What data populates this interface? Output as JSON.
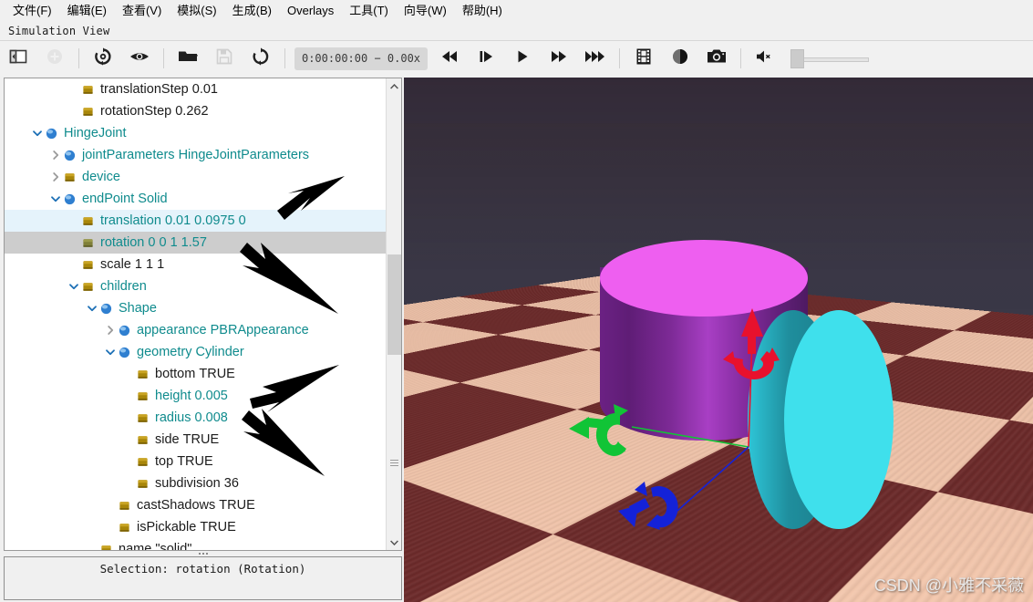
{
  "menu": {
    "items": [
      {
        "label": "文件(F)",
        "name": "menu-file"
      },
      {
        "label": "编辑(E)",
        "name": "menu-edit"
      },
      {
        "label": "查看(V)",
        "name": "menu-view"
      },
      {
        "label": "模拟(S)",
        "name": "menu-simulation"
      },
      {
        "label": "生成(B)",
        "name": "menu-build"
      },
      {
        "label": "Overlays",
        "name": "menu-overlays"
      },
      {
        "label": "工具(T)",
        "name": "menu-tools"
      },
      {
        "label": "向导(W)",
        "name": "menu-wizards"
      },
      {
        "label": "帮助(H)",
        "name": "menu-help"
      }
    ]
  },
  "view_bar": {
    "label": "Simulation View"
  },
  "toolbar": {
    "timecode": "0:00:00:00 −  0.00x",
    "buttons": [
      {
        "name": "toggle-sidebar-button",
        "icon": "panel-toggle-icon",
        "title": "Toggle side panel"
      },
      {
        "name": "add-node-button",
        "icon": "plus-circle-icon",
        "title": "Add node"
      },
      {
        "name": "reload-world-button",
        "icon": "reload-world-icon",
        "title": "Reload world"
      },
      {
        "name": "view-eye-button",
        "icon": "eye-icon",
        "title": "View"
      },
      {
        "name": "open-world-button",
        "icon": "folder-open-icon",
        "title": "Open world"
      },
      {
        "name": "save-world-button",
        "icon": "floppy-save-icon",
        "title": "Save world"
      },
      {
        "name": "reset-simulation-button",
        "icon": "refresh-circular-icon",
        "title": "Reset simulation"
      },
      {
        "name": "rewind-button",
        "icon": "skip-back-icon",
        "title": "Rewind"
      },
      {
        "name": "step-button",
        "icon": "step-forward-icon",
        "title": "Step"
      },
      {
        "name": "play-button",
        "icon": "play-icon",
        "title": "Play"
      },
      {
        "name": "fast-forward-button",
        "icon": "fast-forward-icon",
        "title": "Fast forward"
      },
      {
        "name": "run-fast-button",
        "icon": "run-fast-icon",
        "title": "Run as fast as possible"
      },
      {
        "name": "movie-record-button",
        "icon": "film-strip-icon",
        "title": "Make movie"
      },
      {
        "name": "animation-record-button",
        "icon": "record-circle-icon",
        "title": "Make animation"
      },
      {
        "name": "screenshot-button",
        "icon": "camera-icon",
        "title": "Take screenshot"
      },
      {
        "name": "sound-button",
        "icon": "speaker-mute-icon",
        "title": "Sound volume"
      }
    ]
  },
  "tree": {
    "rows": [
      {
        "name": "tree-item-translationStep",
        "indent": 3,
        "twisty": "none",
        "icon": "field-square-yellow",
        "label": "translationStep",
        "value": "0.01",
        "label_color": "plain",
        "selected": "none"
      },
      {
        "name": "tree-item-rotationStep",
        "indent": 3,
        "twisty": "none",
        "icon": "field-square-yellow",
        "label": "rotationStep",
        "value": "0.262",
        "label_color": "plain",
        "selected": "none"
      },
      {
        "name": "tree-item-HingeJoint",
        "indent": 1,
        "twisty": "open",
        "icon": "node-sphere-blue",
        "label": "HingeJoint",
        "value": "",
        "label_color": "teal",
        "selected": "none"
      },
      {
        "name": "tree-item-jointParameters",
        "indent": 2,
        "twisty": "closed",
        "icon": "node-sphere-blue",
        "label": "jointParameters",
        "value": "HingeJointParameters",
        "label_color": "teal",
        "selected": "none"
      },
      {
        "name": "tree-item-device",
        "indent": 2,
        "twisty": "closed",
        "icon": "field-square-yellow",
        "label": "device",
        "value": "",
        "label_color": "teal",
        "selected": "none"
      },
      {
        "name": "tree-item-endPoint",
        "indent": 2,
        "twisty": "open",
        "icon": "node-sphere-blue",
        "label": "endPoint",
        "value": "Solid",
        "label_color": "teal",
        "selected": "none"
      },
      {
        "name": "tree-item-translation",
        "indent": 3,
        "twisty": "none",
        "icon": "field-square-yellow",
        "label": "translation",
        "value": "0.01 0.0975 0",
        "label_color": "teal",
        "selected": "blue"
      },
      {
        "name": "tree-item-rotation",
        "indent": 3,
        "twisty": "none",
        "icon": "field-square-olive",
        "label": "rotation",
        "value": "0 0 1 1.57",
        "label_color": "teal",
        "selected": "gray"
      },
      {
        "name": "tree-item-scale",
        "indent": 3,
        "twisty": "none",
        "icon": "field-square-yellow",
        "label": "scale",
        "value": "1 1 1",
        "label_color": "plain",
        "selected": "none"
      },
      {
        "name": "tree-item-children",
        "indent": 3,
        "twisty": "open",
        "icon": "field-square-yellow",
        "label": "children",
        "value": "",
        "label_color": "teal",
        "selected": "none"
      },
      {
        "name": "tree-item-Shape",
        "indent": 4,
        "twisty": "open",
        "icon": "node-sphere-blue",
        "label": "Shape",
        "value": "",
        "label_color": "teal",
        "selected": "none"
      },
      {
        "name": "tree-item-appearance",
        "indent": 5,
        "twisty": "closed",
        "icon": "node-sphere-blue",
        "label": "appearance",
        "value": "PBRAppearance",
        "label_color": "teal",
        "selected": "none"
      },
      {
        "name": "tree-item-geometry",
        "indent": 5,
        "twisty": "open",
        "icon": "node-sphere-blue",
        "label": "geometry",
        "value": "Cylinder",
        "label_color": "teal",
        "selected": "none"
      },
      {
        "name": "tree-item-bottom",
        "indent": 6,
        "twisty": "none",
        "icon": "field-square-yellow",
        "label": "bottom",
        "value": "TRUE",
        "label_color": "plain",
        "selected": "none"
      },
      {
        "name": "tree-item-height",
        "indent": 6,
        "twisty": "none",
        "icon": "field-square-yellow",
        "label": "height",
        "value": "0.005",
        "label_color": "teal",
        "selected": "none"
      },
      {
        "name": "tree-item-radius",
        "indent": 6,
        "twisty": "none",
        "icon": "field-square-yellow",
        "label": "radius",
        "value": "0.008",
        "label_color": "teal",
        "selected": "none"
      },
      {
        "name": "tree-item-side",
        "indent": 6,
        "twisty": "none",
        "icon": "field-square-yellow",
        "label": "side",
        "value": "TRUE",
        "label_color": "plain",
        "selected": "none"
      },
      {
        "name": "tree-item-top",
        "indent": 6,
        "twisty": "none",
        "icon": "field-square-yellow",
        "label": "top",
        "value": "TRUE",
        "label_color": "plain",
        "selected": "none"
      },
      {
        "name": "tree-item-subdivision",
        "indent": 6,
        "twisty": "none",
        "icon": "field-square-yellow",
        "label": "subdivision",
        "value": "36",
        "label_color": "plain",
        "selected": "none"
      },
      {
        "name": "tree-item-castShadows",
        "indent": 5,
        "twisty": "none",
        "icon": "field-square-yellow",
        "label": "castShadows",
        "value": "TRUE",
        "label_color": "plain",
        "selected": "none"
      },
      {
        "name": "tree-item-isPickable",
        "indent": 5,
        "twisty": "none",
        "icon": "field-square-yellow",
        "label": "isPickable",
        "value": "TRUE",
        "label_color": "plain",
        "selected": "none"
      },
      {
        "name": "tree-item-name",
        "indent": 4,
        "twisty": "none",
        "icon": "field-square-yellow",
        "label": "name",
        "value": "\"solid\"",
        "label_color": "plain",
        "selected": "none"
      }
    ]
  },
  "status": {
    "text": "Selection: rotation (Rotation)"
  },
  "viewport": {
    "watermark": "CSDN @小雅不采薇",
    "gizmo": {
      "axis_x_color": "#e8112d",
      "axis_y_color": "#11c436",
      "axis_z_color": "#1422d8"
    },
    "objects": [
      {
        "name": "cylinder-magenta",
        "top_color": "#ee5ff0",
        "side_color": "#6b2183"
      },
      {
        "name": "disk-cyan",
        "face_color": "#3fe0ec",
        "side_color": "#1f8e9d"
      }
    ],
    "floor": {
      "dark_tile": "#6d2b2b",
      "light_tile": "#f3c7ad",
      "sky": "#393a4d"
    }
  },
  "colors": {
    "selection_blue": "#e5f3fb",
    "selection_gray": "#cdcdcd",
    "teal_text": "#0f8b8d",
    "chrome": "#f0f0f0"
  }
}
